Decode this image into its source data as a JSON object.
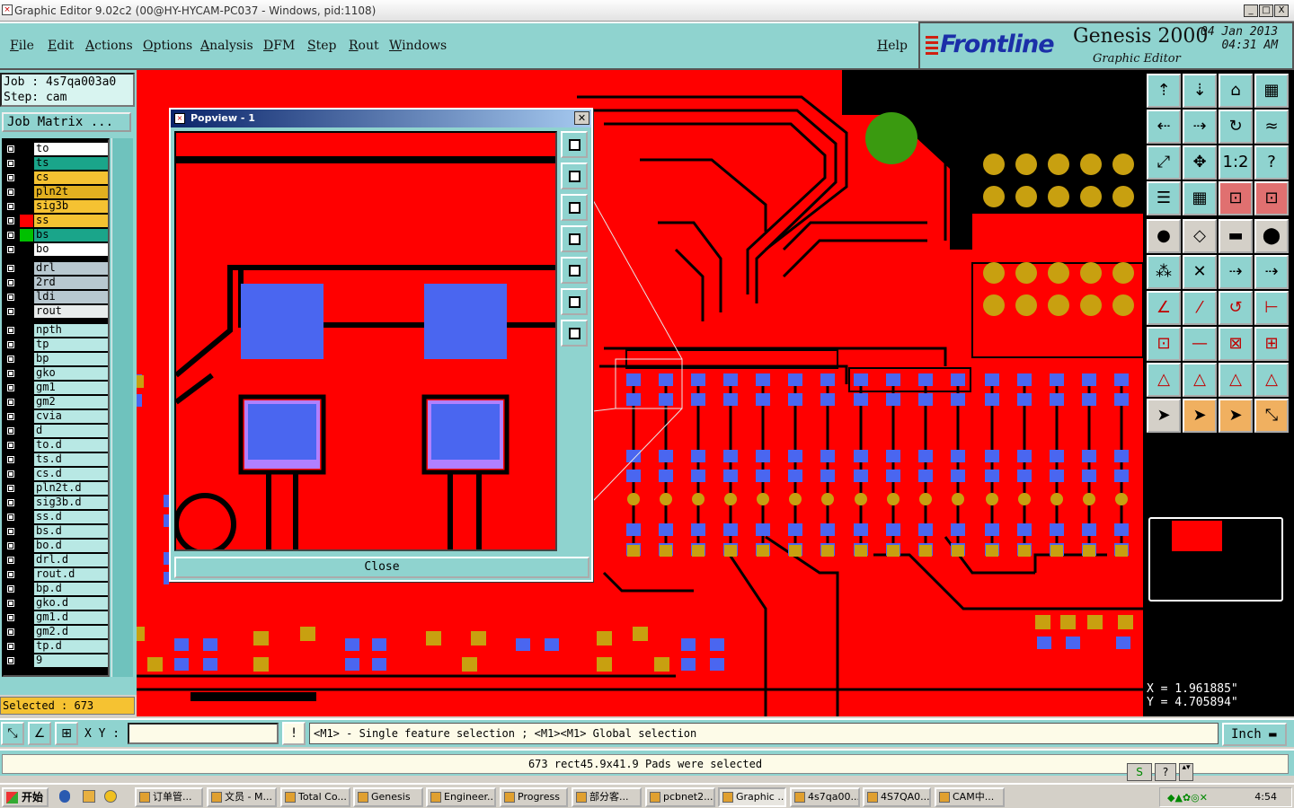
{
  "window": {
    "title": "Graphic Editor 9.02c2 (00@HY-HYCAM-PC037 - Windows, pid:1108)",
    "controls": [
      "_",
      "□",
      "X"
    ]
  },
  "menu": {
    "items": [
      "File",
      "Actions",
      "Options",
      "Analysis",
      "DFM",
      "Step",
      "Rout",
      "Windows"
    ],
    "edit": "Edit",
    "help": "Help"
  },
  "logo": {
    "brand": "Frontline",
    "product": "Genesis 2000",
    "subtitle": "Graphic Editor",
    "date": "04 Jan 2013",
    "time": "04:31 AM"
  },
  "job": {
    "job_line": "Job : 4s7qa003a0",
    "step_line": "Step: cam",
    "matrix_button": "Job Matrix ..."
  },
  "layers": [
    {
      "name": "to",
      "color": "#ffffff"
    },
    {
      "name": "ts",
      "color": "#1aa58a"
    },
    {
      "name": "cs",
      "color": "#f5c232"
    },
    {
      "name": "pln2t",
      "color": "#e2b020"
    },
    {
      "name": "sig3b",
      "color": "#f5c232"
    },
    {
      "name": "ss",
      "color": "#f5c232",
      "marker": "#ff0000"
    },
    {
      "name": "bs",
      "color": "#1aa58a",
      "marker": "#00c000"
    },
    {
      "name": "bo",
      "color": "#ffffff"
    },
    {
      "name": "drl",
      "color": "#b8c8d0"
    },
    {
      "name": "2rd",
      "color": "#b8c8d0"
    },
    {
      "name": "ldi",
      "color": "#b8c8d0"
    },
    {
      "name": "rout",
      "color": "#e8ecec"
    },
    {
      "name": "npth",
      "color": "#b8e8e4"
    },
    {
      "name": "tp",
      "color": "#b8e8e4"
    },
    {
      "name": "bp",
      "color": "#b8e8e4"
    },
    {
      "name": "gko",
      "color": "#b8e8e4"
    },
    {
      "name": "gm1",
      "color": "#b8e8e4"
    },
    {
      "name": "gm2",
      "color": "#b8e8e4"
    },
    {
      "name": "cvia",
      "color": "#b8e8e4"
    },
    {
      "name": "d",
      "color": "#b8e8e4"
    },
    {
      "name": "to.d",
      "color": "#b8e8e4"
    },
    {
      "name": "ts.d",
      "color": "#b8e8e4"
    },
    {
      "name": "cs.d",
      "color": "#b8e8e4"
    },
    {
      "name": "pln2t.d",
      "color": "#b8e8e4"
    },
    {
      "name": "sig3b.d",
      "color": "#b8e8e4"
    },
    {
      "name": "ss.d",
      "color": "#b8e8e4"
    },
    {
      "name": "bs.d",
      "color": "#b8e8e4"
    },
    {
      "name": "bo.d",
      "color": "#b8e8e4"
    },
    {
      "name": "drl.d",
      "color": "#b8e8e4"
    },
    {
      "name": "rout.d",
      "color": "#b8e8e4"
    },
    {
      "name": "bp.d",
      "color": "#b8e8e4"
    },
    {
      "name": "gko.d",
      "color": "#b8e8e4"
    },
    {
      "name": "gm1.d",
      "color": "#b8e8e4"
    },
    {
      "name": "gm2.d",
      "color": "#b8e8e4"
    },
    {
      "name": "tp.d",
      "color": "#b8e8e4"
    },
    {
      "name": "9",
      "color": "#b8e8e4"
    }
  ],
  "popup": {
    "title": "Popview - 1",
    "close_label": "Close"
  },
  "selected": "Selected : 673",
  "command": {
    "xy_label": "X Y :",
    "xy_value": "",
    "prompt": "<M1> - Single feature selection ; <M1><M1> Global selection",
    "units": "Inch"
  },
  "status_message": "673 rect45.9x41.9 Pads were selected",
  "coords": {
    "x": "X = 1.961885\"",
    "y": "Y = 4.705894\""
  },
  "taskbar": {
    "start": "开始",
    "tasks": [
      "订单管...",
      "文员 - M...",
      "Total Co...",
      "Genesis",
      "Engineer...",
      "Progress",
      "部分客...",
      "pcbnet2...",
      "Graphic ...",
      "4s7qa00...",
      "4S7QA0...",
      "CAM中..."
    ],
    "clock": "4:54"
  },
  "colors": {
    "teal": "#8fd3cf",
    "copper": "#ff0000",
    "pad_blue": "#4a66f0",
    "pad_gold": "#c8a010"
  }
}
